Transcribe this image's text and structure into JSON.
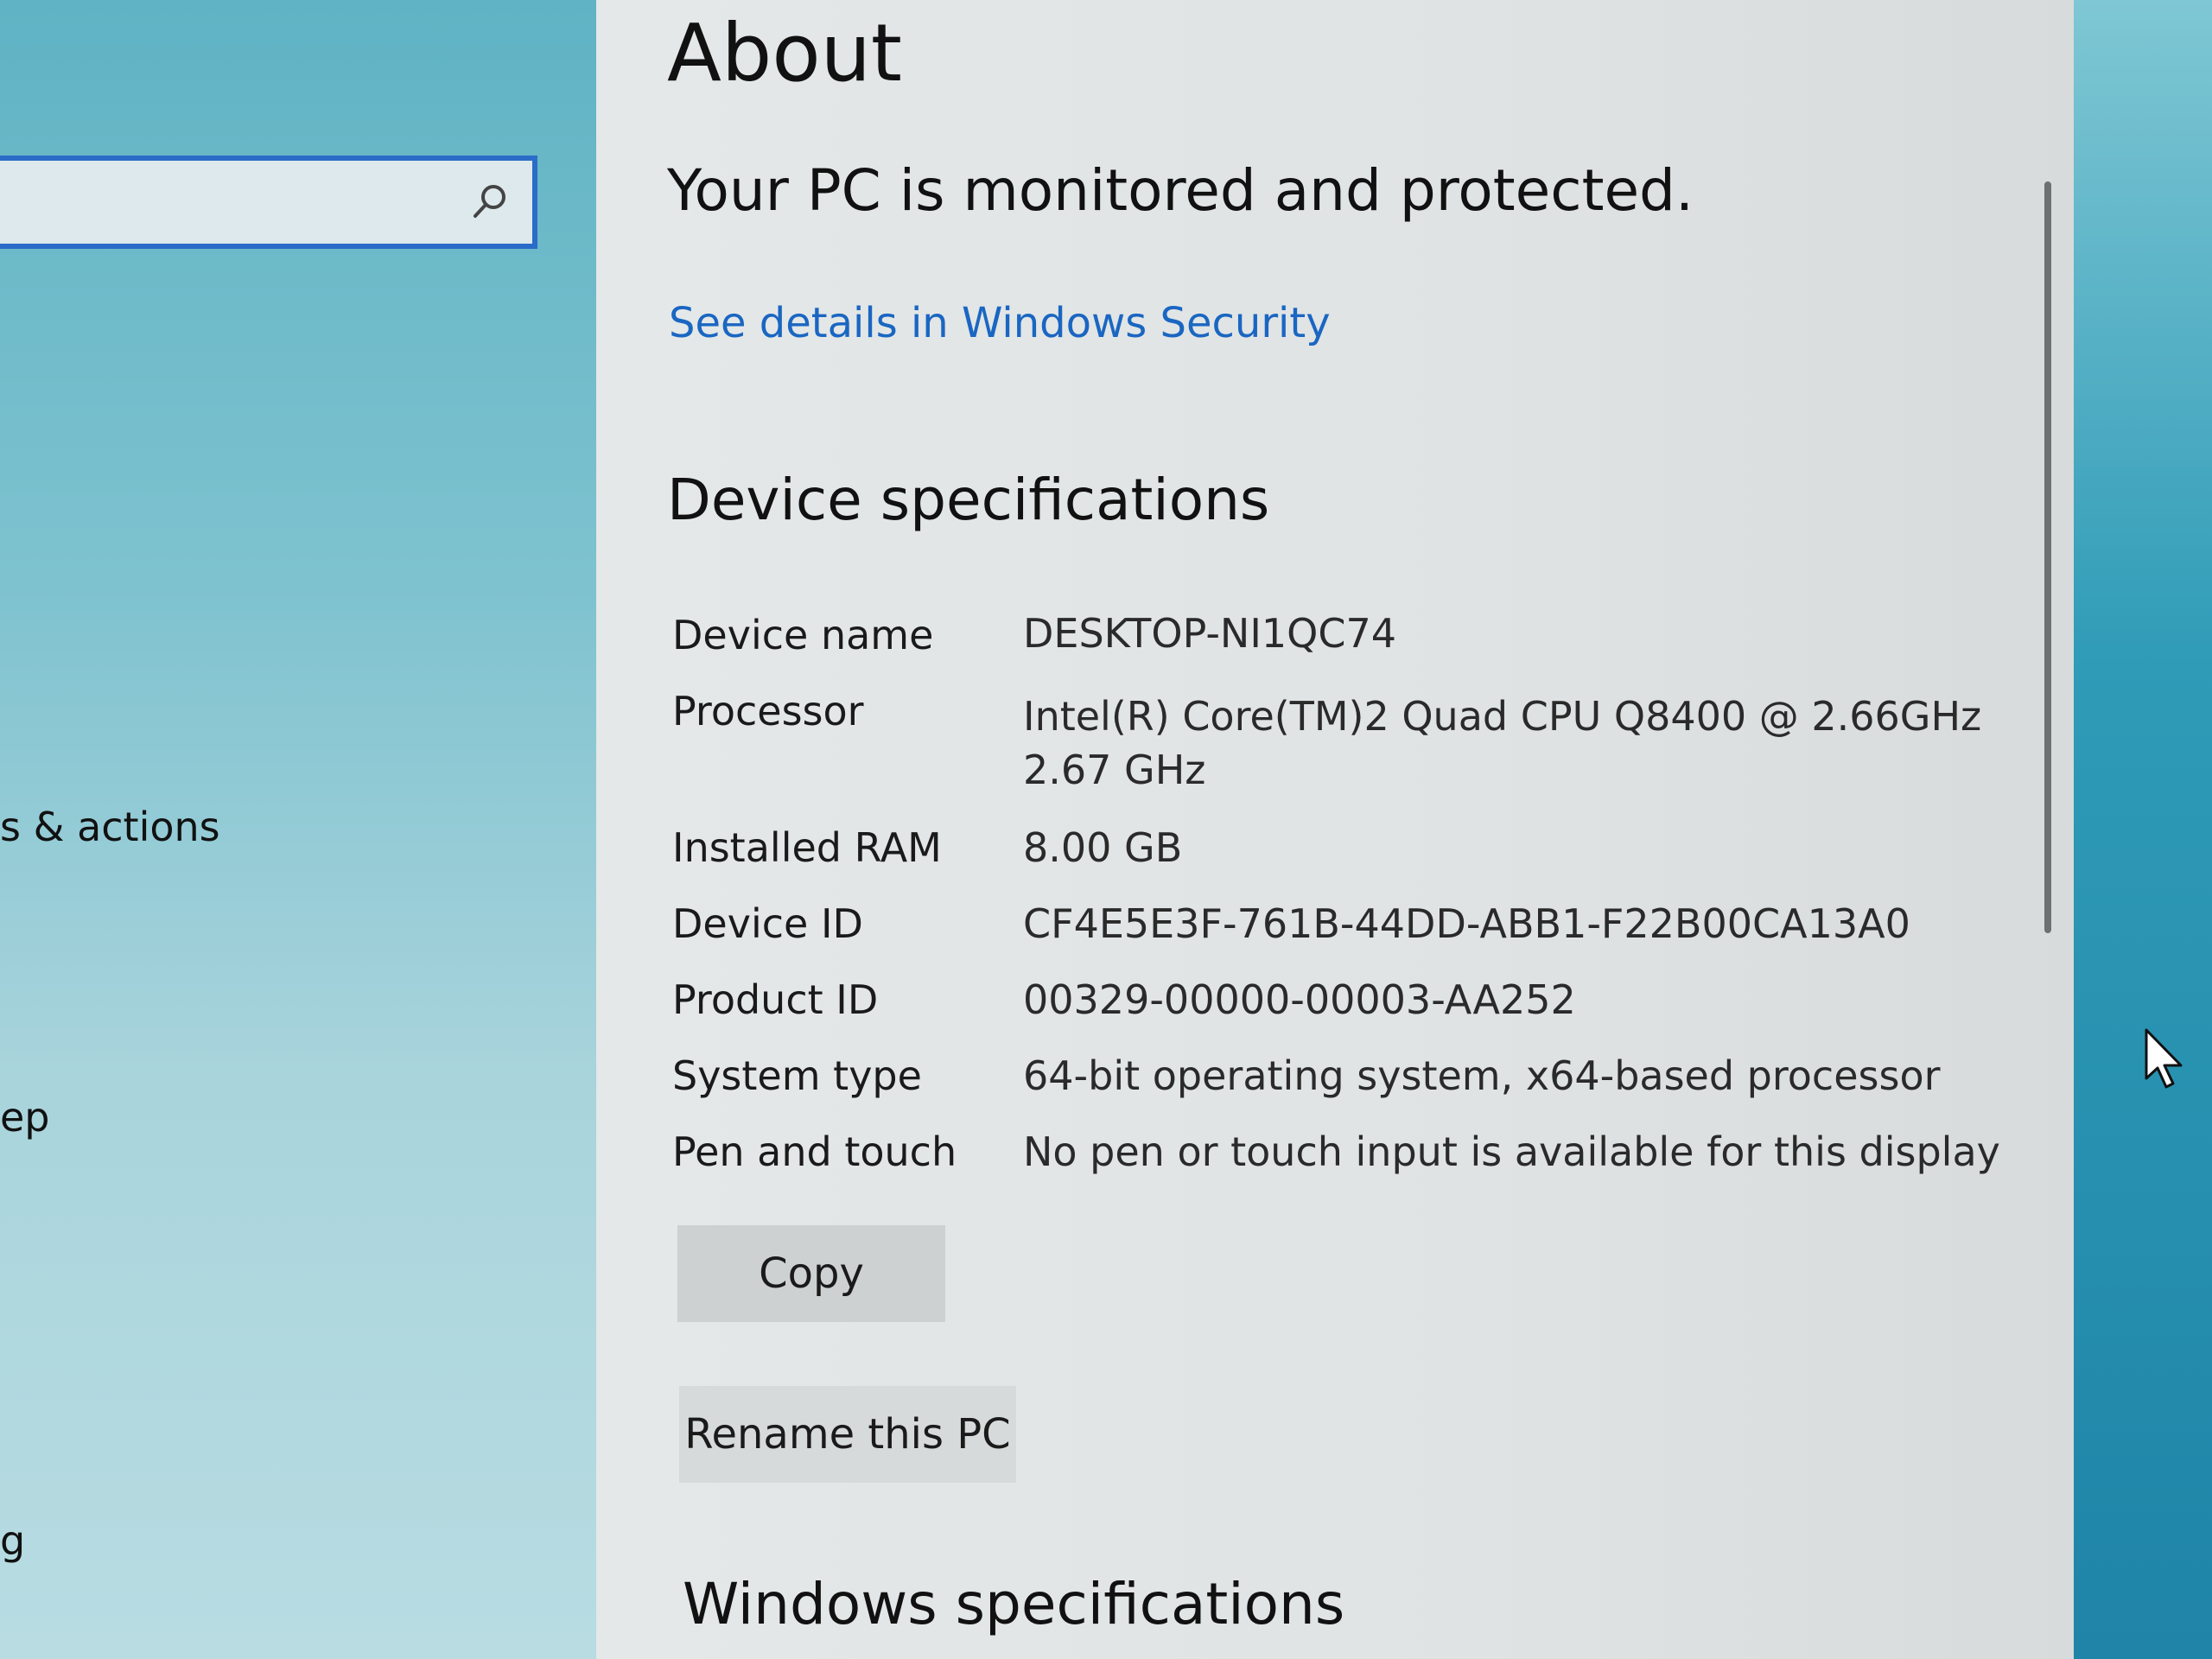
{
  "sidebar": {
    "search_placeholder": "",
    "items": [
      {
        "label": "s & actions"
      },
      {
        "label": "ep"
      },
      {
        "label": "g"
      }
    ]
  },
  "main": {
    "title": "About",
    "protection_status": "Your PC is monitored and protected.",
    "security_link": "See details in Windows Security",
    "device_spec_heading": "Device specifications",
    "specs": [
      {
        "label": "Device name",
        "value": "DESKTOP-NI1QC74"
      },
      {
        "label": "Processor",
        "value": "Intel(R) Core(TM)2 Quad CPU    Q8400  @ 2.66GHz",
        "value2": "2.67 GHz"
      },
      {
        "label": "Installed RAM",
        "value": "8.00 GB"
      },
      {
        "label": "Device ID",
        "value": "CF4E5E3F-761B-44DD-ABB1-F22B00CA13A0"
      },
      {
        "label": "Product ID",
        "value": "00329-00000-00003-AA252"
      },
      {
        "label": "System type",
        "value": "64-bit operating system, x64-based processor"
      },
      {
        "label": "Pen and touch",
        "value": "No pen or touch input is available for this display"
      }
    ],
    "copy_button": "Copy",
    "rename_button": "Rename this PC",
    "windows_spec_heading": "Windows specifications"
  },
  "icons": {
    "search": "search-icon",
    "cursor": "mouse-pointer-icon"
  },
  "colors": {
    "link": "#1a66c2",
    "search_border": "#2a6cc8"
  }
}
